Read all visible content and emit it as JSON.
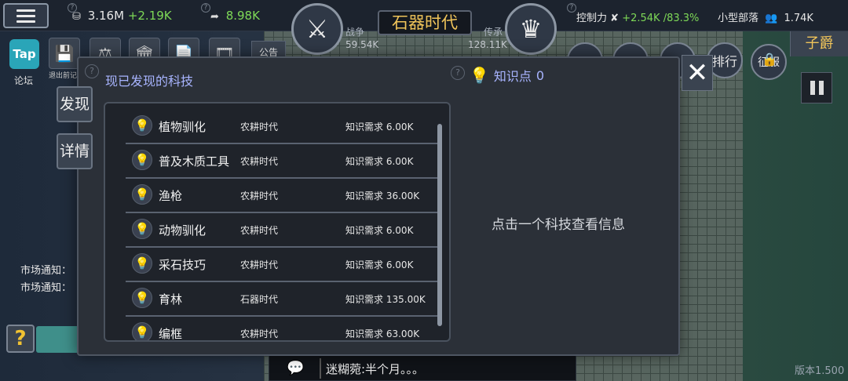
{
  "top": {
    "food": {
      "value": "3.16M",
      "delta": "+2.19K"
    },
    "wood": {
      "value": "8.98K"
    },
    "war": {
      "label": "战争",
      "value": "59.54K"
    },
    "era": "石器时代",
    "legacy": {
      "label": "传承",
      "value": "128.11K"
    },
    "control": {
      "label": "控制力",
      "delta": "+2.54K",
      "percent": "/83.3%"
    },
    "tribe": {
      "label": "小型部落",
      "population": "1.74K"
    }
  },
  "left": {
    "forum": "论坛",
    "save_sub": "退出前记\n得手动保",
    "notice": "公告",
    "market_notes": [
      "市场通知：",
      "市场通知："
    ],
    "help": "?"
  },
  "right": {
    "title": "子爵",
    "rank_button": "排行",
    "conquer_button": "征服",
    "version": "版本1.500"
  },
  "chat": {
    "text": "迷糊菀:半个月。。。"
  },
  "modal": {
    "title": "现已发现的科技",
    "knowledge_label": "知识点",
    "knowledge_value": "0",
    "tabs": [
      "发现",
      "详情"
    ],
    "hint": "点击一个科技查看信息",
    "techs": [
      {
        "name": "植物驯化",
        "era": "农耕时代",
        "req_label": "知识需求",
        "req": "6.00K"
      },
      {
        "name": "普及木质工具",
        "era": "农耕时代",
        "req_label": "知识需求",
        "req": "6.00K"
      },
      {
        "name": "渔枪",
        "era": "农耕时代",
        "req_label": "知识需求",
        "req": "36.00K"
      },
      {
        "name": "动物驯化",
        "era": "农耕时代",
        "req_label": "知识需求",
        "req": "6.00K"
      },
      {
        "name": "采石技巧",
        "era": "农耕时代",
        "req_label": "知识需求",
        "req": "6.00K"
      },
      {
        "name": "育林",
        "era": "石器时代",
        "req_label": "知识需求",
        "req": "135.00K"
      },
      {
        "name": "编框",
        "era": "农耕时代",
        "req_label": "知识需求",
        "req": "63.00K"
      }
    ]
  }
}
